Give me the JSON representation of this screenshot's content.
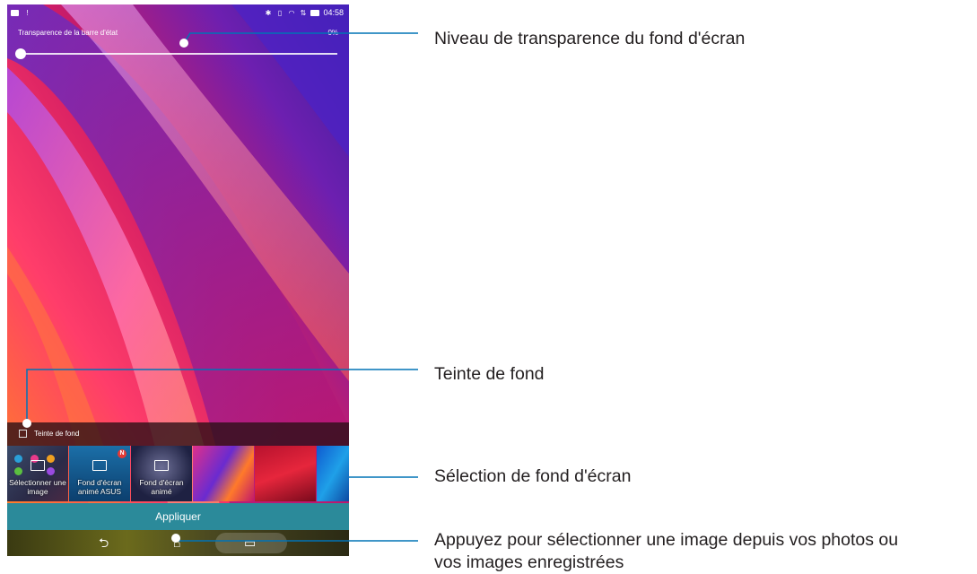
{
  "statusbar": {
    "time": "04:58",
    "left_icons": [
      "image-notification-icon",
      "alert-icon"
    ],
    "right_icons": [
      "bluetooth-icon",
      "vibrate-icon",
      "wifi-icon",
      "data-icon",
      "battery-icon"
    ]
  },
  "transparency": {
    "label": "Transparence de la barre d'état",
    "value_text": "0%",
    "slider_value": 0
  },
  "tint": {
    "label": "Teinte de fond",
    "checked": false
  },
  "thumbnails": [
    {
      "caption": "Sélectionner une image",
      "icon": "image-picker-icon",
      "badge": ""
    },
    {
      "caption": "Fond d'écran animé ASUS",
      "icon": "live-wallpaper-icon",
      "badge": "N"
    },
    {
      "caption": "Fond d'écran animé",
      "icon": "live-wallpaper-icon",
      "badge": ""
    },
    {
      "caption": "",
      "icon": "",
      "badge": ""
    },
    {
      "caption": "",
      "icon": "",
      "badge": ""
    },
    {
      "caption": "",
      "icon": "",
      "badge": ""
    }
  ],
  "apply_label": "Appliquer",
  "navbar": {
    "back_icon": "back-icon",
    "home_icon": "home-icon",
    "recents_icon": "recent-apps-icon"
  },
  "callouts": {
    "transparency": "Niveau de transparence du fond d'écran",
    "tint": "Teinte de fond",
    "selection": "Sélection de fond d'écran",
    "tap_line1": "Appuyez pour sélectionner une image depuis vos photos ou",
    "tap_line2": "vos images enregistrées"
  },
  "colors": {
    "apply_button": "#2b8a9a",
    "callout_line": "#0073b6",
    "callout_text": "#231f20"
  }
}
